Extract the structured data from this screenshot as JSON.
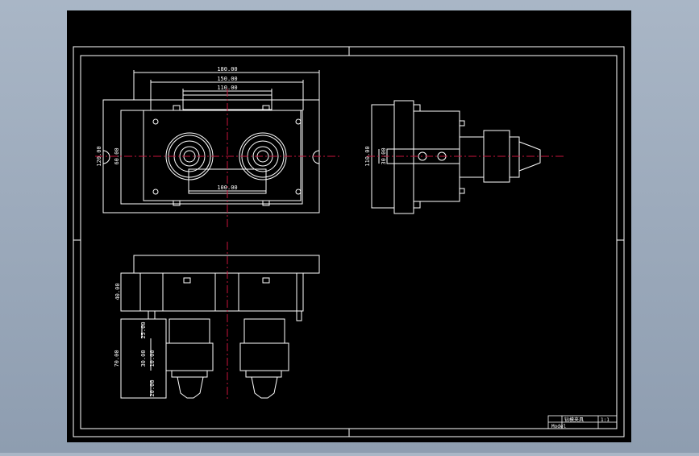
{
  "drawing": {
    "background": "#000000",
    "line_color": "#ffffff",
    "centerline_color": "#c8143c",
    "dimensions": {
      "top_overall_width": "180.00",
      "top_width_2": "150.00",
      "top_width_3": "110.00",
      "top_inner_width": "100.00",
      "top_left_height": "120.00",
      "top_left_height_2": "60.00",
      "side_height": "110.00",
      "side_small": "30.00",
      "front_height_a": "40.00",
      "front_height_b": "25.00",
      "front_height_c": "30.00",
      "front_height_d": "10.00",
      "front_height_e": "20.00",
      "front_total_height": "70.00"
    },
    "title_block": {
      "name": "钻模夹具",
      "scale": "1:1",
      "drawing_no": "Model"
    }
  }
}
